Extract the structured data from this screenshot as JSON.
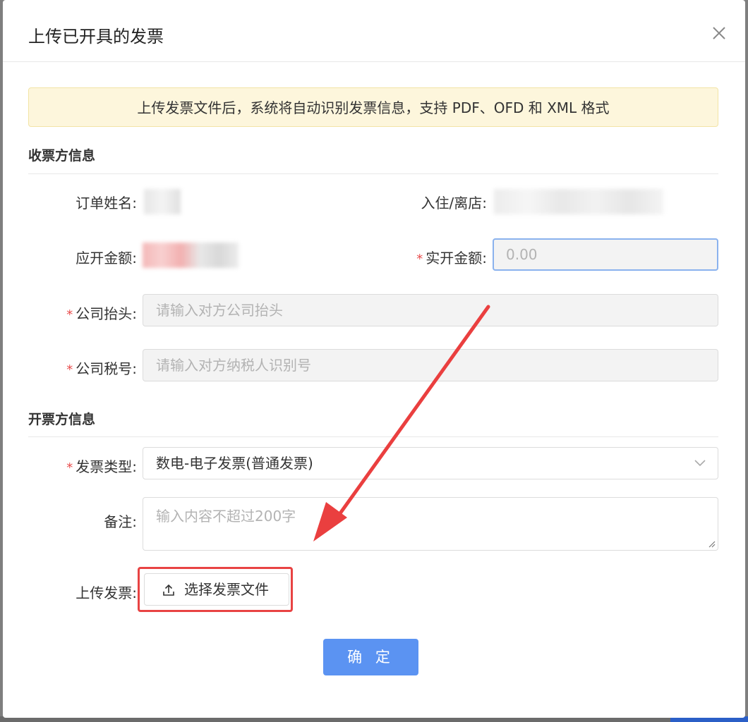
{
  "dialog": {
    "title": "上传已开具的发票",
    "notice": "上传发票文件后，系统将自动识别发票信息，支持 PDF、OFD 和 XML 格式"
  },
  "payee_section": {
    "title": "收票方信息",
    "order_name_label": "订单姓名:",
    "stay_label": "入住/离店:",
    "due_amount_label": "应开金额:",
    "actual_amount_label": "实开金额:",
    "actual_amount_placeholder": "0.00",
    "company_title_label": "公司抬头:",
    "company_title_placeholder": "请输入对方公司抬头",
    "tax_id_label": "公司税号:",
    "tax_id_placeholder": "请输入对方纳税人识别号"
  },
  "issuer_section": {
    "title": "开票方信息",
    "invoice_type_label": "发票类型:",
    "invoice_type_value": "数电-电子发票(普通发票)",
    "remark_label": "备注:",
    "remark_placeholder": "输入内容不超过200字",
    "upload_label": "上传发票:",
    "upload_button": "选择发票文件"
  },
  "actions": {
    "confirm": "确 定"
  },
  "required_mark": "*",
  "colors": {
    "required": "#e84c4c",
    "primary_button": "#5b93f2",
    "notice_bg": "#fdf6dc",
    "annotation_red": "#e84343"
  },
  "icons": {
    "close": "close-icon",
    "chevron": "chevron-down-icon",
    "upload": "upload-icon",
    "resize": "resize-grip-icon"
  }
}
